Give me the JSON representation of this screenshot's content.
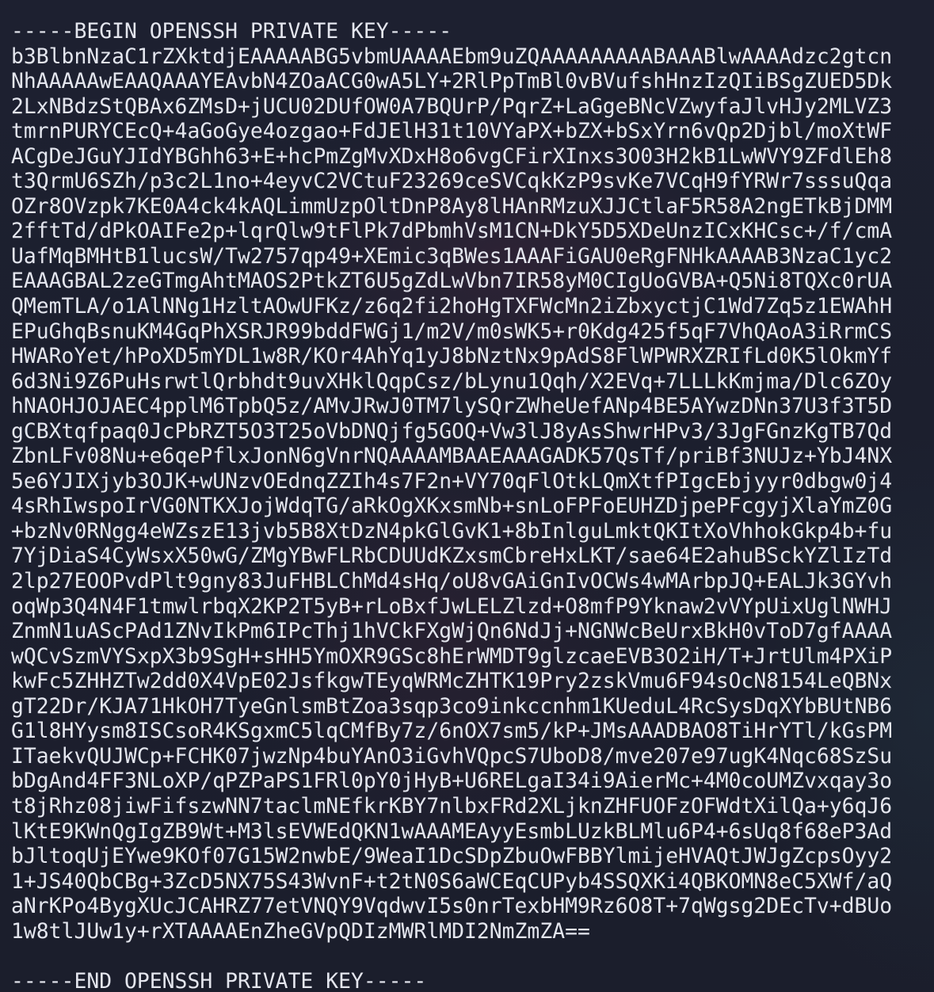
{
  "terminal": {
    "begin_marker": "-----BEGIN OPENSSH PRIVATE KEY-----",
    "key_lines": [
      "b3BlbnNzaC1rZXktdjEAAAAABG5vbmUAAAAEbm9uZQAAAAAAAAABAAABlwAAAAdzc2gtcn",
      "NhAAAAAwEAAQAAAYEAvbN4ZOaACG0wA5LY+2RlPpTmBl0vBVufshHnzIzQIiBSgZUED5Dk",
      "2LxNBdzStQBAx6ZMsD+jUCU02DUfOW0A7BQUrP/PqrZ+LaGgeBNcVZwyfaJlvHJy2MLVZ3",
      "tmrnPURYCEcQ+4aGoGye4ozgao+FdJElH31t10VYaPX+bZX+bSxYrn6vQp2Djbl/moXtWF",
      "ACgDeJGuYJIdYBGhh63+E+hcPmZgMvXDxH8o6vgCFirXInxs3O03H2kB1LwWVY9ZFdlEh8",
      "t3QrmU6SZh/p3c2L1no+4eyvC2VCtuF23269ceSVCqkKzP9svKe7VCqH9fYRWr7sssuQqa",
      "OZr8OVzpk7KE0A4ck4kAQLimmUzpOltDnP8Ay8lHAnRMzuXJJCtlaF5R58A2ngETkBjDMM",
      "2fftTd/dPkOAIFe2p+lqrQlw9tFlPk7dPbmhVsM1CN+DkY5D5XDeUnzICxKHCsc+/f/cmA",
      "UafMqBMHtB1lucsW/Tw2757qp49+XEmic3qBWes1AAAFiGAU0eRgFNHkAAAAB3NzaC1yc2",
      "EAAAGBAL2zeGTmgAhtMAOS2PtkZT6U5gZdLwVbn7IR58yM0CIgUoGVBA+Q5Ni8TQXc0rUA",
      "QMemTLA/o1AlNNg1HzltAOwUFKz/z6q2fi2hoHgTXFWcMn2iZbxyctjC1Wd7Zq5z1EWAhH",
      "EPuGhqBsnuKM4GqPhXSRJR99bddFWGj1/m2V/m0sWK5+r0Kdg425f5qF7VhQAoA3iRrmCS",
      "HWARoYet/hPoXD5mYDL1w8R/KOr4AhYq1yJ8bNztNx9pAdS8FlWPWRXZRIfLd0K5lOkmYf",
      "6d3Ni9Z6PuHsrwtlQrbhdt9uvXHklQqpCsz/bLynu1Qqh/X2EVq+7LLLkKmjma/Dlc6ZOy",
      "hNAOHJOJAEC4pplM6TpbQ5z/AMvJRwJ0TM7lySQrZWheUefANp4BE5AYwzDNn37U3f3T5D",
      "gCBXtqfpaq0JcPbRZT5O3T25oVbDNQjfg5GOQ+Vw3lJ8yAsShwrHPv3/3JgFGnzKgTB7Qd",
      "ZbnLFv08Nu+e6qePflxJonN6gVnrNQAAAAMBAAEAAAGADK57QsTf/priBf3NUJz+YbJ4NX",
      "5e6YJIXjyb3OJK+wUNzvOEdnqZZIh4s7F2n+VY70qFlOtkLQmXtfPIgcEbjyyr0dbgw0j4",
      "4sRhIwspoIrVG0NTKXJojWdqTG/aRkOgXKxsmNb+snLoFPFoEUHZDjpePFcgyjXlaYmZ0G",
      "+bzNv0RNgg4eWZszE13jvb5B8XtDzN4pkGlGvK1+8bInlguLmktQKItXoVhhokGkp4b+fu",
      "7YjDiaS4CyWsxX50wG/ZMgYBwFLRbCDUUdKZxsmCbreHxLKT/sae64E2ahuBSckYZlIzTd",
      "2lp27EOOPvdPlt9gny83JuFHBLChMd4sHq/oU8vGAiGnIvOCWs4wMArbpJQ+EALJk3GYvh",
      "oqWp3Q4N4F1tmwlrbqX2KP2T5yB+rLoBxfJwLELZlzd+O8mfP9Yknaw2vVYpUixUglNWHJ",
      "ZnmN1uAScPAd1ZNvIkPm6IPcThj1hVCkFXgWjQn6NdJj+NGNWcBeUrxBkH0vToD7gfAAAA",
      "wQCvSzmVYSxpX3b9SgH+sHH5YmOXR9GSc8hErWMDT9glzcaeEVB3O2iH/T+JrtUlm4PXiP",
      "kwFc5ZHHZTw2dd0X4VpE02JsfkgwTEyqWRMcZHTK19Pry2zskVmu6F94sOcN8154LeQBNx",
      "gT22Dr/KJA71HkOH7TyeGnlsmBtZoa3sqp3co9inkccnhm1KUeduL4RcSysDqXYbBUtNB6",
      "G1l8HYysm8ISCsoR4KSgxmC5lqCMfBy7z/6nOX7sm5/kP+JMsAAADBAO8TiHrYTl/kGsPM",
      "ITaekvQUJWCp+FCHK07jwzNp4buYAnO3iGvhVQpcS7UboD8/mve207e97ugK4Nqc68SzSu",
      "bDgAnd4FF3NLoXP/qPZPaPS1FRl0pY0jHyB+U6RELgaI34i9AierMc+4M0coUMZvxqay3o",
      "t8jRhz08jiwFifszwNN7taclmNEfkrKBY7nlbxFRd2XLjknZHFUOFzOFWdtXilQa+y6qJ6",
      "lKtE9KWnQgIgZB9Wt+M3lsEVWEdQKN1wAAAMEAyyEsmbLUzkBLMlu6P4+6sUq8f68eP3Ad",
      "bJltoqUjEYwe9KOf07G15W2nwbE/9WeaI1DcSDpZbuOwFBBYlmijeHVAQtJWJgZcpsOyy2",
      "1+JS40QbCBg+3ZcD5NX75S43WvnF+t2tN0S6aWCEqCUPyb4SSQXKi4QBKOMN8eC5XWf/aQ",
      "aNrKPo4BygXUcJCAHRZ77etVNQY9VqdwvI5s0nrTexbHM9Rz6O8T+7qWgsg2DEcTv+dBUo",
      "1w8tlJUw1y+rXTAAAAEnZheGVpQDIzMWRlMDI2NmZmZA=="
    ],
    "end_marker": "-----END OPENSSH PRIVATE KEY-----",
    "colors": {
      "background": "#1c1f2e",
      "text": "#e4e6ee"
    }
  }
}
